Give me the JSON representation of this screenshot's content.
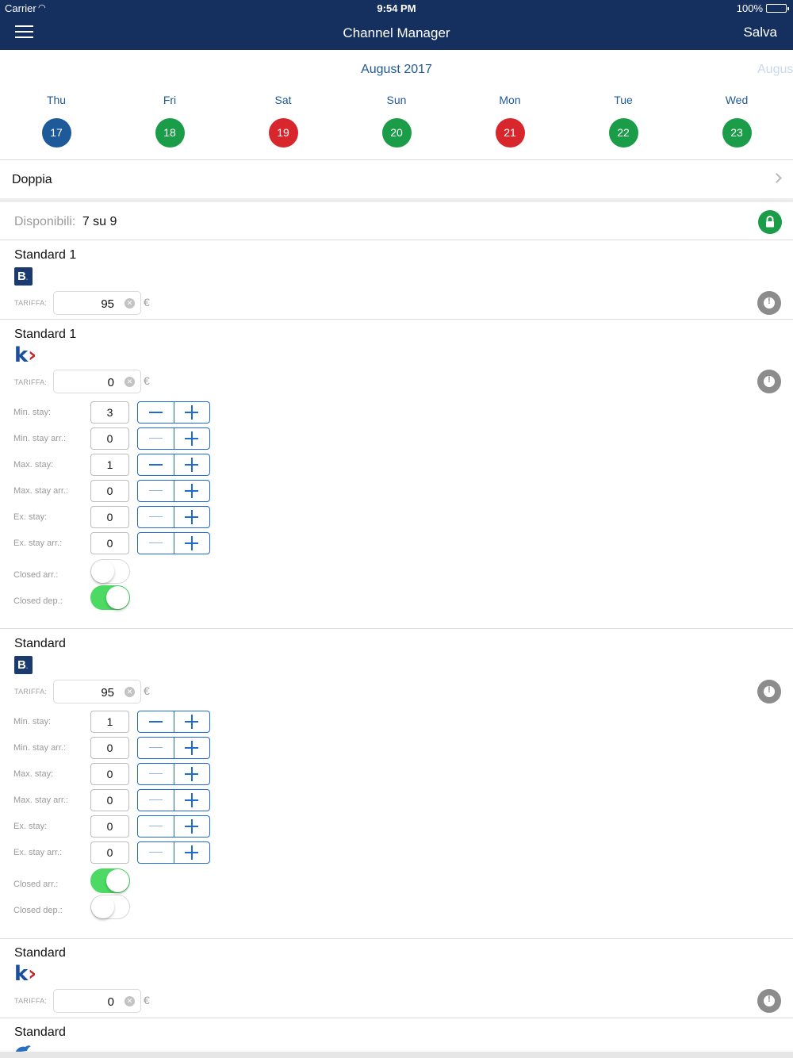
{
  "status": {
    "carrier": "Carrier",
    "time": "9:54 PM",
    "battery": "100%"
  },
  "nav": {
    "title": "Channel Manager",
    "save": "Salva"
  },
  "calendar": {
    "month": "August 2017",
    "next_month": "Augus",
    "days": [
      {
        "name": "Thu",
        "num": "17",
        "color": "#1e5a9a"
      },
      {
        "name": "Fri",
        "num": "18",
        "color": "#1a9c48"
      },
      {
        "name": "Sat",
        "num": "19",
        "color": "#d7262c"
      },
      {
        "name": "Sun",
        "num": "20",
        "color": "#1a9c48"
      },
      {
        "name": "Mon",
        "num": "21",
        "color": "#d7262c"
      },
      {
        "name": "Tue",
        "num": "22",
        "color": "#1a9c48"
      },
      {
        "name": "Wed",
        "num": "23",
        "color": "#1a9c48"
      }
    ]
  },
  "room": {
    "name": "Doppia"
  },
  "availability": {
    "label": "Disponibili:",
    "value": "7 su 9"
  },
  "tariff_label": "TARIFFA:",
  "currency": "€",
  "blocks": [
    {
      "title": "Standard 1",
      "logo": "booking-logo",
      "logo_text": "B",
      "tariff": "95"
    },
    {
      "title": "Standard 1",
      "logo": "k-logo",
      "logo_text": "k",
      "tariff": "0",
      "stays": [
        {
          "label": "Min. stay:",
          "value": "3"
        },
        {
          "label": "Min. stay arr.:",
          "value": "0"
        },
        {
          "label": "Max. stay:",
          "value": "1"
        },
        {
          "label": "Max. stay arr.:",
          "value": "0"
        },
        {
          "label": "Ex. stay:",
          "value": "0"
        },
        {
          "label": "Ex. stay arr.:",
          "value": "0"
        }
      ],
      "toggles": [
        {
          "label": "Closed arr.:",
          "on": false
        },
        {
          "label": "Closed dep.:",
          "on": true
        }
      ]
    },
    {
      "title": "Standard",
      "logo": "booking-logo",
      "logo_text": "B",
      "tariff": "95",
      "stays": [
        {
          "label": "Min. stay:",
          "value": "1"
        },
        {
          "label": "Min. stay arr.:",
          "value": "0"
        },
        {
          "label": "Max. stay:",
          "value": "0"
        },
        {
          "label": "Max. stay arr.:",
          "value": "0"
        },
        {
          "label": "Ex. stay:",
          "value": "0"
        },
        {
          "label": "Ex. stay arr.:",
          "value": "0"
        }
      ],
      "toggles": [
        {
          "label": "Closed arr.:",
          "on": true
        },
        {
          "label": "Closed dep.:",
          "on": false
        }
      ]
    },
    {
      "title": "Standard",
      "logo": "k-logo",
      "logo_text": "k",
      "tariff": "0"
    },
    {
      "title": "Standard",
      "logo": "bird-logo"
    }
  ]
}
